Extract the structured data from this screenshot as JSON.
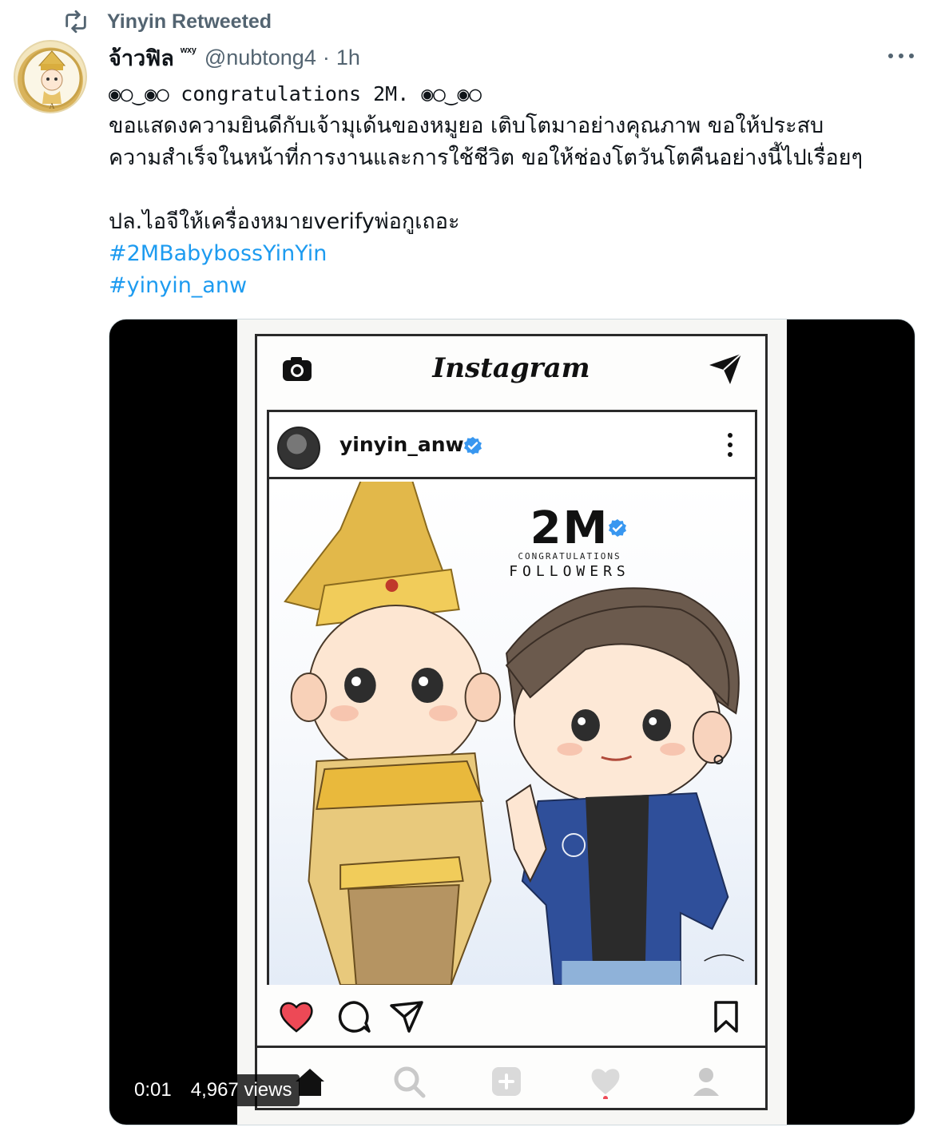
{
  "retweet": {
    "label": "Yinyin Retweeted"
  },
  "author": {
    "name": "จ้าวฟิล",
    "sup": "ʷˣʸ",
    "handle": "@nubtong4",
    "separator": "·",
    "time": "1h"
  },
  "tweet": {
    "line1": "◉◯‿◉◯ congratulations 2M. ◉◯‿◉◯",
    "line2": "ขอแสดงความยินดีกับเจ้ามุเด้นของหมูยอ เติบโตมาอย่างคุณภาพ ขอให้ประสบ",
    "line3": "ความสำเร็จในหน้าที่การงานและการใช้ชีวิต ขอให้ช่องโตวันโตคืนอย่างนี้ไปเรื่อยๆ",
    "line4": "ปล.ไอจีให้เครื่องหมายverifyพ่อกูเถอะ",
    "hashtag1": "#2MBabybossYinYin",
    "hashtag2": "#yinyin_anw"
  },
  "media": {
    "ig_logo": "Instagram",
    "ig_username": "yinyin_anw",
    "count": "2M",
    "congrats": "CONGRATULATIONS",
    "followers": "FOLLOWERS",
    "time": "0:01",
    "views": "4,967 views"
  },
  "colors": {
    "link": "#1d9bf0",
    "secondary": "#536471",
    "verified": "#3897f0",
    "heart": "#ed4956"
  }
}
